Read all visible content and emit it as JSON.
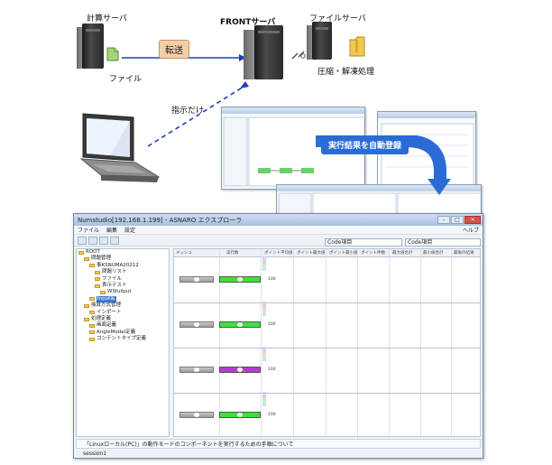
{
  "diagram": {
    "calc_server_label": "計算サーバ",
    "front_server_label": "FRONTサーバ",
    "file_server_label": "ファイルサーバ",
    "file_label": "ファイル",
    "transfer_label": "転送",
    "compress_label": "圧縮・解凍処理",
    "instruction_label": "指示だけ",
    "auto_register_label": "実行結果を自動登録"
  },
  "window": {
    "title": "Numstudio[192.168.1.199] - ASNARO エクスプローラ",
    "menus": [
      "ファイル",
      "編集",
      "設定"
    ],
    "help": "ヘルプ",
    "combo1": "Code項目",
    "combo2": "Code項目",
    "tree": [
      {
        "label": "ROOT",
        "indent": 0,
        "sel": false
      },
      {
        "label": "問題管理",
        "indent": 1,
        "sel": false
      },
      {
        "label": "事KSNUMA20212",
        "indent": 2,
        "sel": false
      },
      {
        "label": "問題リスト",
        "indent": 3,
        "sel": false
      },
      {
        "label": "ファイル",
        "indent": 3,
        "sel": false
      },
      {
        "label": "表示テスト",
        "indent": 3,
        "sel": false
      },
      {
        "label": "WSfullput",
        "indent": 4,
        "sel": false
      },
      {
        "label": "Input名",
        "indent": 2,
        "sel": true
      },
      {
        "label": "換算方式管理",
        "indent": 1,
        "sel": false
      },
      {
        "label": "インポート",
        "indent": 2,
        "sel": false
      },
      {
        "label": "処理定義",
        "indent": 1,
        "sel": false
      },
      {
        "label": "画面定義",
        "indent": 2,
        "sel": false
      },
      {
        "label": "AngleModel定義",
        "indent": 2,
        "sel": false
      },
      {
        "label": "コンテントタイプ定義",
        "indent": 2,
        "sel": false
      }
    ],
    "grid_headers": [
      "メッシュ",
      "実行数",
      "ポイント平均値",
      "ポイント最大値",
      "ポイント最小値",
      "ポイント件数",
      "最大値合計",
      "最小値合計",
      "最後の結果"
    ],
    "row_colors": [
      "#39e339",
      "#39e339",
      "#b63bd9",
      "#39e339"
    ],
    "row_value": "100",
    "status_text": "「Linuxローカル(PC)」の動作モードのコンポーネントを実行するための手順について",
    "status2": "session1"
  }
}
